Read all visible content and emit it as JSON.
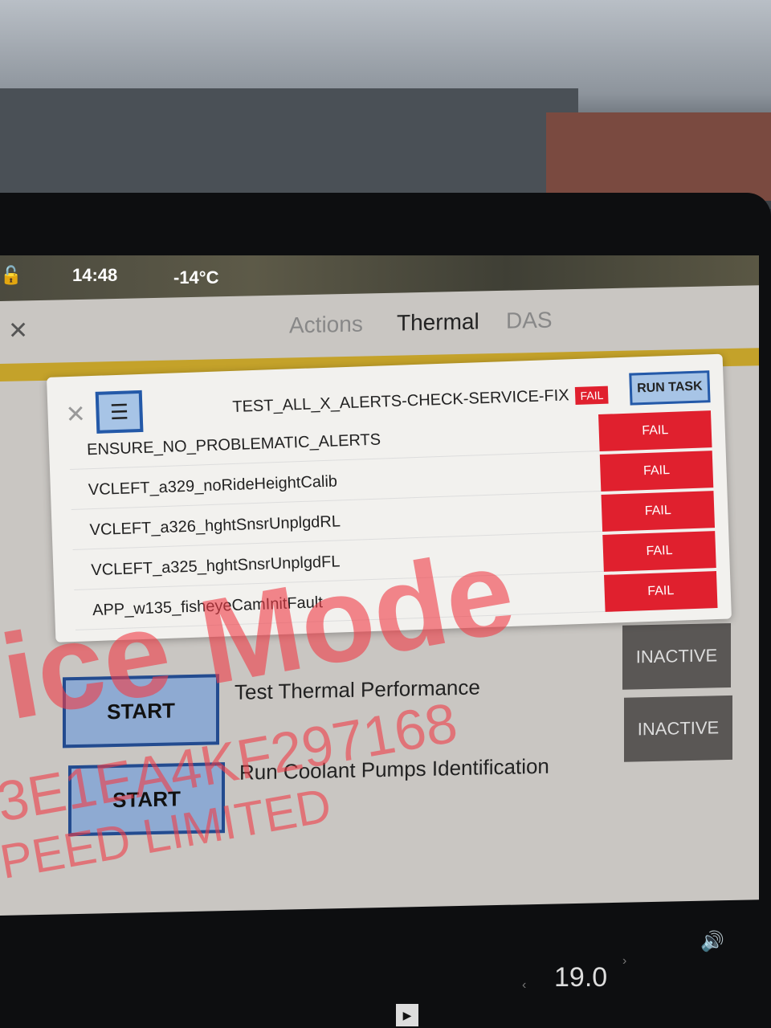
{
  "status_bar": {
    "time": "14:48",
    "temperature": "-14°C"
  },
  "tabs": [
    {
      "label": "Actions"
    },
    {
      "label": "Thermal"
    },
    {
      "label": "DAS"
    }
  ],
  "popup": {
    "title": "TEST_ALL_X_ALERTS-CHECK-SERVICE-FIX",
    "status": "FAIL",
    "run_label": "RUN TASK",
    "items": [
      {
        "name": "ENSURE_NO_PROBLEMATIC_ALERTS",
        "status": "FAIL"
      },
      {
        "name": "VCLEFT_a329_noRideHeightCalib",
        "status": "FAIL"
      },
      {
        "name": "VCLEFT_a326_hghtSnsrUnplgdRL",
        "status": "FAIL"
      },
      {
        "name": "VCLEFT_a325_hghtSnsrUnplgdFL",
        "status": "FAIL"
      },
      {
        "name": "APP_w135_fisheyeCamInitFault",
        "status": "FAIL"
      }
    ]
  },
  "tests": [
    {
      "start_label": "START",
      "name": "Test Thermal Performance",
      "status": "INACTIVE"
    },
    {
      "start_label": "START",
      "name": "Run Coolant Pumps Identification",
      "status": "INACTIVE"
    }
  ],
  "watermark": {
    "mode": "ice Mode",
    "vin": "3E1EA4KF297168",
    "limit": "PEED LIMITED"
  },
  "bottom_bar": {
    "temperature_setting": "19.0"
  },
  "colors": {
    "fail": "#e0202e",
    "button": "#a7c4e6",
    "accent_strip": "#c4a22a",
    "inactive": "#5a5755"
  }
}
